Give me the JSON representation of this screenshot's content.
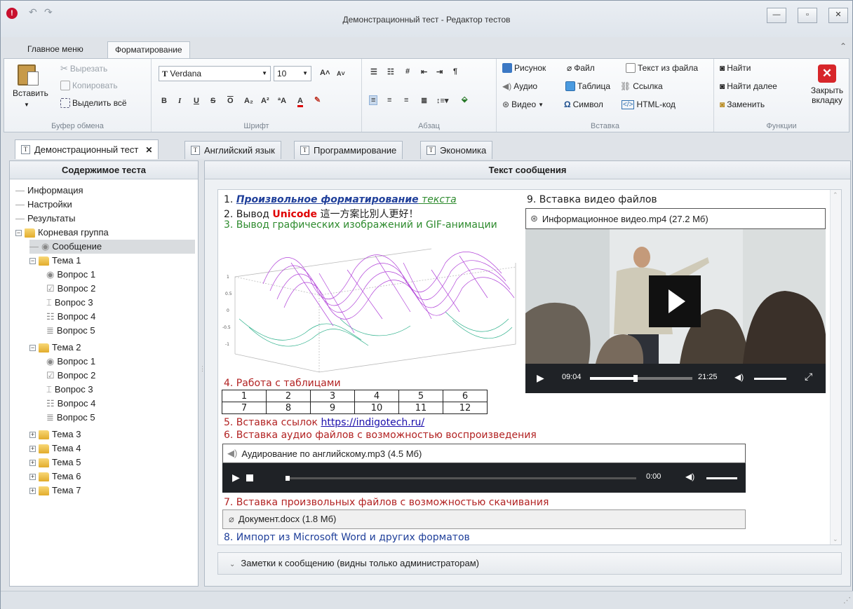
{
  "window": {
    "title": "Демонстрационный тест - Редактор тестов"
  },
  "ribbon_tabs": [
    "Главное меню",
    "Форматирование"
  ],
  "clipboard": {
    "paste": "Вставить",
    "cut": "Вырезать",
    "copy": "Копировать",
    "select_all": "Выделить всё",
    "label": "Буфер обмена"
  },
  "font": {
    "family": "Verdana",
    "size": "10",
    "label": "Шрифт"
  },
  "paragraph": {
    "label": "Абзац"
  },
  "insert": {
    "picture": "Рисунок",
    "audio": "Аудио",
    "video": "Видео",
    "file": "Файл",
    "table": "Таблица",
    "symbol": "Символ",
    "text_from_file": "Текст из файла",
    "link": "Ссылка",
    "html": "HTML-код",
    "label": "Вставка"
  },
  "functions": {
    "find": "Найти",
    "find_next": "Найти далее",
    "replace": "Заменить",
    "close_tab_1": "Закрыть",
    "close_tab_2": "вкладку",
    "label": "Функции"
  },
  "doc_tabs": [
    "Демонстрационный тест",
    "Английский язык",
    "Программирование",
    "Экономика"
  ],
  "left_panel": {
    "title": "Содержимое теста",
    "items": [
      "Информация",
      "Настройки",
      "Результаты",
      "Корневая группа",
      "Сообщение",
      "Тема 1",
      "Вопрос 1",
      "Вопрос 2",
      "Вопрос 3",
      "Вопрос 4",
      "Вопрос 5",
      "Тема 2",
      "Вопрос 1",
      "Вопрос 2",
      "Вопрос 3",
      "Вопрос 4",
      "Вопрос 5",
      "Тема 3",
      "Тема 4",
      "Тема 5",
      "Тема 6",
      "Тема 7"
    ]
  },
  "right_panel": {
    "title": "Текст сообщения"
  },
  "message": {
    "l1_num": "1. ",
    "l1_a": "Произвольное форматирование",
    "l1_b": " текста",
    "l2_a": "2. Вывод ",
    "l2_b": "Unicode",
    "l2_c": " 這一方案比別人更好！",
    "l3": "3. Вывод графических изображений и GIF-анимации",
    "l4": "4. Работа с таблицами",
    "table": [
      [
        "1",
        "2",
        "3",
        "4",
        "5",
        "6"
      ],
      [
        "7",
        "8",
        "9",
        "10",
        "11",
        "12"
      ]
    ],
    "l5_a": "5. Вставка ссылок ",
    "l5_b": "https://indigotech.ru/",
    "l6": "6. Вставка аудио файлов с возможностью воспроизведения",
    "audio_title": "Аудирование по английскому.mp3 (4.5 Мб)",
    "audio_time": "0:00",
    "l7": "7. Вставка произвольных файлов с возможностью скачивания",
    "file_title": "Документ.docx (1.8 Мб)",
    "l8": "8. Импорт из Microsoft Word и других форматов",
    "l9": "9. Вставка видео файлов",
    "video_title": "Информационное видео.mp4 (27.2 Мб)",
    "video_time": "09:04",
    "video_duration": "21:25"
  },
  "notes": "Заметки к сообщению (видны только администраторам)",
  "colors": {
    "accent": "#1a0dab",
    "green": "#2e8b2e",
    "red": "#b22222",
    "unicode_red": "#e00000",
    "blue_text": "#1f3f9a"
  }
}
